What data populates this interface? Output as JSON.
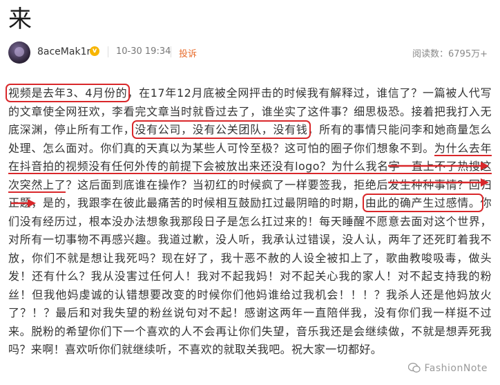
{
  "title": "来",
  "meta": {
    "username": "8aceMak1r",
    "badge": "v",
    "datetime": "10-30 19:34",
    "report": "投诉",
    "views": "阅读数：6795万+"
  },
  "body": {
    "s1": "视频是去年3、4月份的",
    "s2": "，在17年12月底被全网抨击的时候我有解释过，谁信了？一篇被人代写的文章使全网狂欢，李看完文章当时就昏过去了，谁坐实了这件事？细思极恐。接着把我打入无底深渊，停止所有工作，",
    "s3": "没有公司，没有公关团队，没有钱",
    "s4": "，所有的事情只能问李和她商量怎么处理、怎么面对。你们真的天真以为某些人可怜至极？这可怕的圈子你们想象不到。",
    "s5": "为什么去年在抖音拍的视频没有任何外传的前提下会被放出来还没有logo？为什么我名字一直上不了热搜这次突然上了",
    "s6": "？这后面到底谁在操作？当初红的时候疯了一样要签我，拒绝后发生种种事情？回归正题，是的，我跟李在彼此最痛苦的时候相互鼓励扛过最阴暗的时期，",
    "s7": "由此的确产生过感情。",
    "s8": "你们没有经历过，根本没办法想象我那段日子是怎么扛过来的！每天睡醒不愿意去面对这个世界，对所有一切事物不再感兴趣。我道过歉，没人听，我承认过错误，没人认，两年了还死盯着我不放，你们不就是想让我死吗？现在好了，我十恶不赦的人设全被扣上了，歌曲教唆吸毒，做头发！还有什么？我从没害过任何人！我对不起我妈！对不起关心我的家人！对不起支持我的粉丝！但我他妈虔诚的认错想要改变的时候你们他妈谁给过我机会！！！？我杀人还是他妈放火了？！？最后和对我失望的粉丝说句对不起！感谢这两年一直陪伴我，没有你们我一样挺不过来。脱粉的希望你们下一个喜欢的人不会再让你们失望，音乐我还是会继续做，不就是想弄死我吗？来啊！喜欢听你们就继续听，不喜欢的就取关我吧。祝大家一切都好。"
  },
  "watermark": "FashionNote",
  "colors": {
    "annotation": "#d9272a",
    "report": "#e86c2c",
    "badge": "#f7b500"
  }
}
